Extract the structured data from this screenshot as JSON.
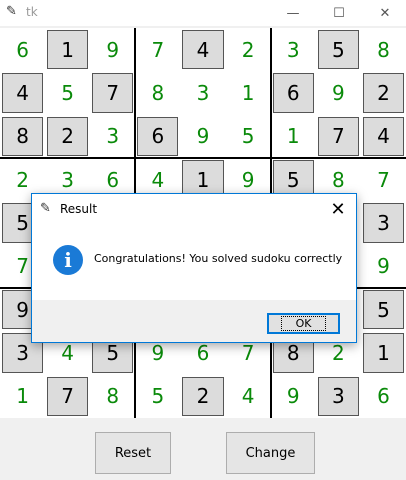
{
  "window": {
    "title": "tk",
    "controls": {
      "minimize": "—",
      "maximize": "☐",
      "close": "✕"
    }
  },
  "board": {
    "rows": [
      [
        {
          "v": "6",
          "g": false
        },
        {
          "v": "1",
          "g": true
        },
        {
          "v": "9",
          "g": false
        },
        {
          "v": "7",
          "g": false
        },
        {
          "v": "4",
          "g": true
        },
        {
          "v": "2",
          "g": false
        },
        {
          "v": "3",
          "g": false
        },
        {
          "v": "5",
          "g": true
        },
        {
          "v": "8",
          "g": false
        }
      ],
      [
        {
          "v": "4",
          "g": true
        },
        {
          "v": "5",
          "g": false
        },
        {
          "v": "7",
          "g": true
        },
        {
          "v": "8",
          "g": false
        },
        {
          "v": "3",
          "g": false
        },
        {
          "v": "1",
          "g": false
        },
        {
          "v": "6",
          "g": true
        },
        {
          "v": "9",
          "g": false
        },
        {
          "v": "2",
          "g": true
        }
      ],
      [
        {
          "v": "8",
          "g": true
        },
        {
          "v": "2",
          "g": true
        },
        {
          "v": "3",
          "g": false
        },
        {
          "v": "6",
          "g": true
        },
        {
          "v": "9",
          "g": false
        },
        {
          "v": "5",
          "g": false
        },
        {
          "v": "1",
          "g": false
        },
        {
          "v": "7",
          "g": true
        },
        {
          "v": "4",
          "g": true
        }
      ],
      [
        {
          "v": "2",
          "g": false
        },
        {
          "v": "3",
          "g": false
        },
        {
          "v": "6",
          "g": false
        },
        {
          "v": "4",
          "g": false
        },
        {
          "v": "1",
          "g": true
        },
        {
          "v": "9",
          "g": false
        },
        {
          "v": "5",
          "g": true
        },
        {
          "v": "8",
          "g": false
        },
        {
          "v": "7",
          "g": false
        }
      ],
      [
        {
          "v": "5",
          "g": true
        },
        {
          "v": "",
          "g": false
        },
        {
          "v": "",
          "g": false
        },
        {
          "v": "",
          "g": false
        },
        {
          "v": "",
          "g": false
        },
        {
          "v": "",
          "g": false
        },
        {
          "v": "",
          "g": false
        },
        {
          "v": "",
          "g": false
        },
        {
          "v": "3",
          "g": true
        }
      ],
      [
        {
          "v": "7",
          "g": false
        },
        {
          "v": "",
          "g": false
        },
        {
          "v": "",
          "g": false
        },
        {
          "v": "",
          "g": false
        },
        {
          "v": "",
          "g": false
        },
        {
          "v": "",
          "g": false
        },
        {
          "v": "",
          "g": false
        },
        {
          "v": "",
          "g": false
        },
        {
          "v": "9",
          "g": false
        }
      ],
      [
        {
          "v": "9",
          "g": true
        },
        {
          "v": "",
          "g": false
        },
        {
          "v": "",
          "g": false
        },
        {
          "v": "",
          "g": false
        },
        {
          "v": "",
          "g": false
        },
        {
          "v": "",
          "g": false
        },
        {
          "v": "",
          "g": false
        },
        {
          "v": "",
          "g": false
        },
        {
          "v": "5",
          "g": true
        }
      ],
      [
        {
          "v": "3",
          "g": true
        },
        {
          "v": "4",
          "g": false
        },
        {
          "v": "5",
          "g": true
        },
        {
          "v": "9",
          "g": false
        },
        {
          "v": "6",
          "g": false
        },
        {
          "v": "7",
          "g": false
        },
        {
          "v": "8",
          "g": true
        },
        {
          "v": "2",
          "g": false
        },
        {
          "v": "1",
          "g": true
        }
      ],
      [
        {
          "v": "1",
          "g": false
        },
        {
          "v": "7",
          "g": true
        },
        {
          "v": "8",
          "g": false
        },
        {
          "v": "5",
          "g": false
        },
        {
          "v": "2",
          "g": true
        },
        {
          "v": "4",
          "g": false
        },
        {
          "v": "9",
          "g": false
        },
        {
          "v": "3",
          "g": true
        },
        {
          "v": "6",
          "g": false
        }
      ]
    ]
  },
  "buttons": {
    "reset": "Reset",
    "change": "Change"
  },
  "dialog": {
    "title": "Result",
    "close": "✕",
    "info_icon": "i",
    "message": "Congratulations! You solved sudoku correctly",
    "ok": "OK"
  },
  "colors": {
    "user_digit": "#0a8a0a",
    "given_bg": "#dcdcdc",
    "dialog_accent": "#0078d7"
  }
}
